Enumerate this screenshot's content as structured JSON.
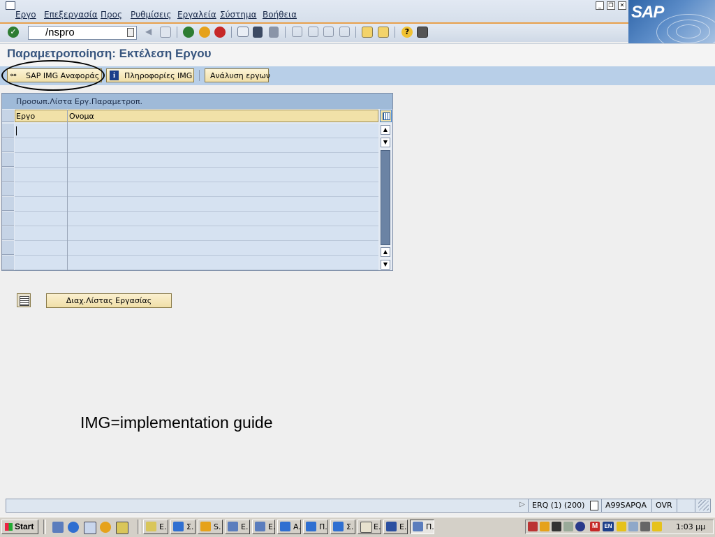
{
  "menu": [
    "Εργο",
    "Επεξεργασία",
    "Προς",
    "Ρυθμίσεις",
    "Εργαλεία",
    "Σύστημα",
    "Βοήθεια"
  ],
  "logo_text": "SAP",
  "command_field": {
    "value": "/nspro"
  },
  "page_title": "Παραμετροποίηση: Εκτέλεση Εργου",
  "app_toolbar": {
    "sap_img_reference": "SAP IMG Αναφοράς",
    "img_info": "Πληροφορίες IMG",
    "project_analysis": "Ανάλυση εργων"
  },
  "table": {
    "title": "Προσωπ.Λίστα Εργ.Παραμετροπ.",
    "columns": [
      "Εργο",
      "Ονομα"
    ],
    "rows": [
      "",
      "",
      "",
      "",
      "",
      "",
      "",
      "",
      "",
      ""
    ]
  },
  "worklist_button": "Διαχ.Λίστας Εργασίας",
  "caption": "IMG=implementation guide",
  "status": {
    "system": "ERQ (1) (200)",
    "server": "A99SAPQA",
    "mode": "OVR"
  },
  "taskbar": {
    "start": "Start",
    "tasks": [
      "E.",
      "Σ.",
      "S.",
      "E.",
      "E.",
      "A.",
      "Π.",
      "Σ.",
      "E.",
      "E.",
      "Π."
    ],
    "tray_lang": "EN",
    "clock": "1:03 μμ"
  },
  "icons": {
    "toolbar": [
      "check-icon",
      "back-icon",
      "exit-icon",
      "cancel-icon",
      "print-icon",
      "find-icon",
      "find-next-icon",
      "first-page-icon",
      "prev-page-icon",
      "next-page-icon",
      "last-page-icon",
      "new-session-icon",
      "shortcut-icon",
      "help-icon",
      "layout-icon"
    ]
  },
  "colors": {
    "title": "#37557e",
    "accent": "#e8a04b",
    "app_toolbar": "#b8cfe8"
  }
}
